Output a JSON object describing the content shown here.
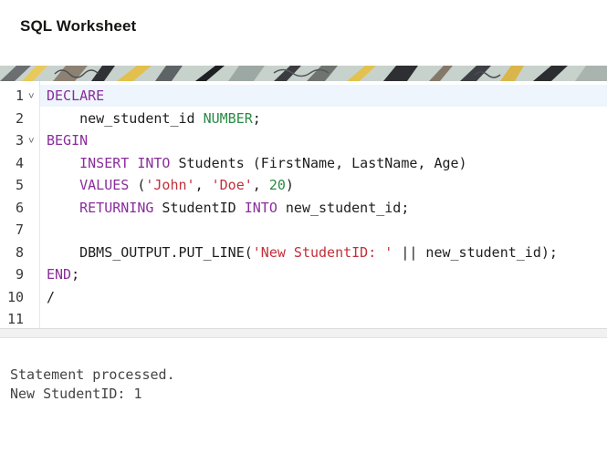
{
  "header": {
    "title": "SQL Worksheet"
  },
  "editor": {
    "line_numbers": [
      "1",
      "2",
      "3",
      "4",
      "5",
      "6",
      "7",
      "8",
      "9",
      "10",
      "11"
    ],
    "fold_icon": "chevron-down",
    "lines": [
      [
        {
          "t": "DECLARE",
          "c": "kw"
        }
      ],
      [
        {
          "t": "    new_student_id ",
          "c": ""
        },
        {
          "t": "NUMBER",
          "c": "type"
        },
        {
          "t": ";",
          "c": ""
        }
      ],
      [
        {
          "t": "BEGIN",
          "c": "kw"
        }
      ],
      [
        {
          "t": "    ",
          "c": ""
        },
        {
          "t": "INSERT INTO",
          "c": "kw"
        },
        {
          "t": " Students (FirstName, LastName, Age)",
          "c": ""
        }
      ],
      [
        {
          "t": "    ",
          "c": ""
        },
        {
          "t": "VALUES",
          "c": "kw"
        },
        {
          "t": " (",
          "c": ""
        },
        {
          "t": "'John'",
          "c": "str"
        },
        {
          "t": ", ",
          "c": ""
        },
        {
          "t": "'Doe'",
          "c": "str"
        },
        {
          "t": ", ",
          "c": ""
        },
        {
          "t": "20",
          "c": "num-lit"
        },
        {
          "t": ")",
          "c": ""
        }
      ],
      [
        {
          "t": "    ",
          "c": ""
        },
        {
          "t": "RETURNING",
          "c": "kw"
        },
        {
          "t": " StudentID ",
          "c": ""
        },
        {
          "t": "INTO",
          "c": "kw"
        },
        {
          "t": " new_student_id;",
          "c": ""
        }
      ],
      [
        {
          "t": "",
          "c": ""
        }
      ],
      [
        {
          "t": "    DBMS_OUTPUT.PUT_LINE(",
          "c": ""
        },
        {
          "t": "'New StudentID: '",
          "c": "str"
        },
        {
          "t": " || new_student_id);",
          "c": ""
        }
      ],
      [
        {
          "t": "END",
          "c": "kw"
        },
        {
          "t": ";",
          "c": ""
        }
      ],
      [
        {
          "t": "/",
          "c": ""
        }
      ],
      [
        {
          "t": "",
          "c": ""
        }
      ]
    ]
  },
  "output": {
    "lines": [
      "Statement processed.",
      "New StudentID: 1"
    ]
  },
  "colors": {
    "keyword": "#8a2d9c",
    "string": "#c1303a",
    "number": "#2a8a45",
    "active_line": "#eef5fc"
  }
}
